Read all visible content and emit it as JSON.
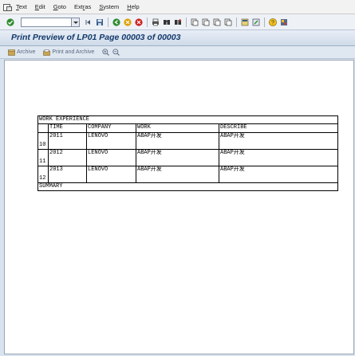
{
  "menubar": {
    "items": [
      {
        "u": "T",
        "rest": "ext"
      },
      {
        "u": "E",
        "rest": "dit"
      },
      {
        "u": "G",
        "rest": "oto"
      },
      {
        "u": "",
        "pre": "Ext",
        "mid": "r",
        "rest": "as"
      },
      {
        "u": "S",
        "rest": "ystem"
      },
      {
        "u": "H",
        "rest": "elp"
      }
    ]
  },
  "toolbar": {
    "command_field_value": ""
  },
  "title": "Print Preview of LP01 Page 00003 of 00003",
  "app_toolbar": {
    "archive_label": "Archive",
    "print_archive_label": "Print and Archive"
  },
  "report": {
    "section_title": "WORK EXPERIENCE",
    "columns": [
      "TIME",
      "COMPANY",
      "WORK",
      "DESCRIBE"
    ],
    "rows": [
      {
        "num": "10",
        "time": "2011",
        "company": "LENOVO",
        "work": "ABAP开发",
        "describe": "ABAP开发"
      },
      {
        "num": "11",
        "time": "2012",
        "company": "LENOVO",
        "work": "ABAP开发",
        "describe": "ABAP开发"
      },
      {
        "num": "12",
        "time": "2013",
        "company": "LENOVO",
        "work": "ABAP开发",
        "describe": "ABAP开发"
      }
    ],
    "summary": "SUMMARY"
  }
}
